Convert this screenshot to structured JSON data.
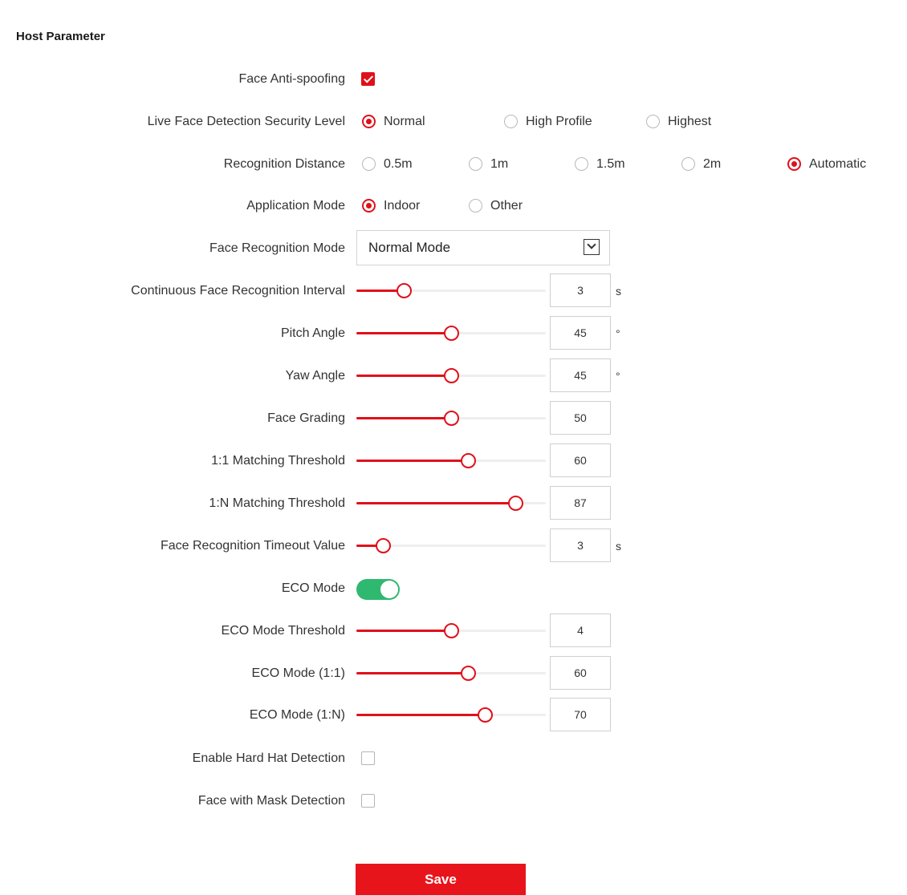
{
  "section_title": "Host Parameter",
  "colors": {
    "accent": "#e0101a",
    "toggle_on": "#2fb86f",
    "button": "#e8141c"
  },
  "face_anti_spoofing": {
    "label": "Face Anti-spoofing",
    "checked": true
  },
  "live_face_detection": {
    "label": "Live Face Detection Security Level",
    "options": [
      "Normal",
      "High Profile",
      "Highest"
    ],
    "selected": "Normal"
  },
  "recognition_distance": {
    "label": "Recognition Distance",
    "options": [
      "0.5m",
      "1m",
      "1.5m",
      "2m",
      "Automatic"
    ],
    "selected": "Automatic"
  },
  "application_mode": {
    "label": "Application Mode",
    "options": [
      "Indoor",
      "Other"
    ],
    "selected": "Indoor"
  },
  "face_recognition_mode": {
    "label": "Face Recognition Mode",
    "value": "Normal Mode",
    "icon": "chevron-down-icon"
  },
  "continuous_interval": {
    "label": "Continuous Face Recognition Interval",
    "value": "3",
    "unit": "s",
    "level": 0.25
  },
  "pitch_angle": {
    "label": "Pitch Angle",
    "value": "45",
    "unit": "°",
    "level": 0.5
  },
  "yaw_angle": {
    "label": "Yaw Angle",
    "value": "45",
    "unit": "°",
    "level": 0.5
  },
  "face_grading": {
    "label": "Face Grading",
    "value": "50",
    "level": 0.5
  },
  "matching_1_1": {
    "label": "1:1 Matching Threshold",
    "value": "60",
    "level": 0.59
  },
  "matching_1_n": {
    "label": "1:N Matching Threshold",
    "value": "87",
    "level": 0.84
  },
  "timeout_value": {
    "label": "Face Recognition Timeout Value",
    "value": "3",
    "unit": "s",
    "level": 0.14
  },
  "eco_mode": {
    "label": "ECO Mode",
    "on": true
  },
  "eco_threshold": {
    "label": "ECO Mode Threshold",
    "value": "4",
    "level": 0.5
  },
  "eco_1_1": {
    "label": "ECO Mode (1:1)",
    "value": "60",
    "level": 0.59
  },
  "eco_1_n": {
    "label": "ECO Mode (1:N)",
    "value": "70",
    "level": 0.68
  },
  "hard_hat": {
    "label": "Enable Hard Hat Detection",
    "checked": false
  },
  "mask_detection": {
    "label": "Face with Mask Detection",
    "checked": false
  },
  "save_button": "Save"
}
